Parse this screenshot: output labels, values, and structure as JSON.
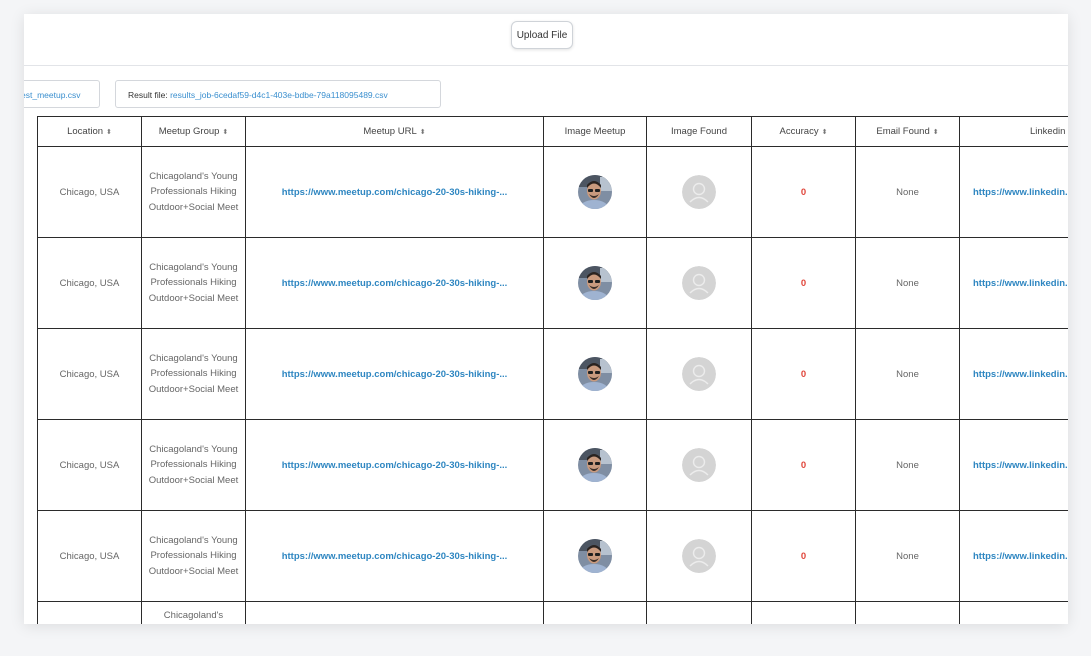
{
  "toolbar": {
    "upload_label": "Upload File"
  },
  "files": {
    "input_file": "est_meetup.csv",
    "result_label": "Result file:",
    "result_file": "results_job-6cedaf59-d4c1-403e-bdbe-79a118095489.csv"
  },
  "table": {
    "headers": {
      "location": "Location",
      "meetup_group": "Meetup Group",
      "meetup_url": "Meetup URL",
      "image_meetup": "Image Meetup",
      "image_found": "Image Found",
      "accuracy": "Accuracy",
      "email_found": "Email Found",
      "linkedin": "Linkedin"
    },
    "rows": [
      {
        "location": "Chicago, USA",
        "group": "Chicagoland's Young Professionals Hiking Outdoor+Social Meet",
        "url": "https://www.meetup.com/chicago-20-30s-hiking-...",
        "accuracy": "0",
        "email": "None",
        "linkedin": "https://www.linkedin."
      },
      {
        "location": "Chicago, USA",
        "group": "Chicagoland's Young Professionals Hiking Outdoor+Social Meet",
        "url": "https://www.meetup.com/chicago-20-30s-hiking-...",
        "accuracy": "0",
        "email": "None",
        "linkedin": "https://www.linkedin."
      },
      {
        "location": "Chicago, USA",
        "group": "Chicagoland's Young Professionals Hiking Outdoor+Social Meet",
        "url": "https://www.meetup.com/chicago-20-30s-hiking-...",
        "accuracy": "0",
        "email": "None",
        "linkedin": "https://www.linkedin."
      },
      {
        "location": "Chicago, USA",
        "group": "Chicagoland's Young Professionals Hiking Outdoor+Social Meet",
        "url": "https://www.meetup.com/chicago-20-30s-hiking-...",
        "accuracy": "0",
        "email": "None",
        "linkedin": "https://www.linkedin."
      },
      {
        "location": "Chicago, USA",
        "group": "Chicagoland's Young Professionals Hiking Outdoor+Social Meet",
        "url": "https://www.meetup.com/chicago-20-30s-hiking-...",
        "accuracy": "0",
        "email": "None",
        "linkedin": "https://www.linkedin."
      }
    ],
    "partial_row": {
      "group": "Chicagoland's"
    }
  },
  "colors": {
    "link": "#2e86c1",
    "accuracy_zero": "#e0463b",
    "border": "#2b2b2b"
  },
  "icons": {
    "sort": "sort-arrows-icon",
    "placeholder": "user-placeholder-icon",
    "photo": "user-photo-avatar"
  }
}
